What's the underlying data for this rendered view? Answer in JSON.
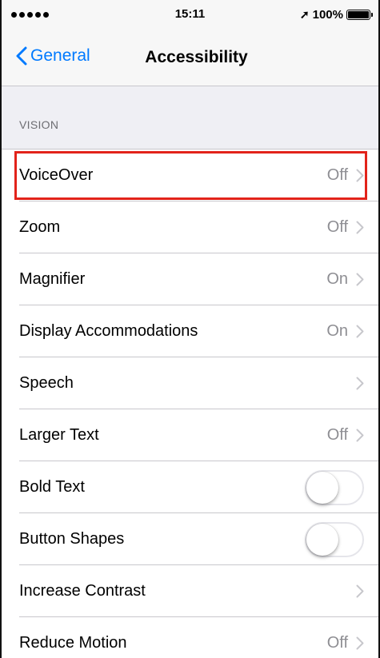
{
  "status_bar": {
    "time": "15:11",
    "location_icon": "location-arrow-icon",
    "battery_percent_label": "100%",
    "battery_level": 1.0
  },
  "nav": {
    "back_label": "General",
    "title": "Accessibility"
  },
  "section": {
    "header": "VISION",
    "rows": [
      {
        "label": "VoiceOver",
        "value": "Off",
        "type": "disclosure",
        "highlighted": true
      },
      {
        "label": "Zoom",
        "value": "Off",
        "type": "disclosure"
      },
      {
        "label": "Magnifier",
        "value": "On",
        "type": "disclosure"
      },
      {
        "label": "Display Accommodations",
        "value": "On",
        "type": "disclosure"
      },
      {
        "label": "Speech",
        "value": "",
        "type": "disclosure"
      },
      {
        "label": "Larger Text",
        "value": "Off",
        "type": "disclosure"
      },
      {
        "label": "Bold Text",
        "type": "toggle",
        "on": false
      },
      {
        "label": "Button Shapes",
        "type": "toggle",
        "on": false
      },
      {
        "label": "Increase Contrast",
        "value": "",
        "type": "disclosure"
      },
      {
        "label": "Reduce Motion",
        "value": "Off",
        "type": "disclosure"
      }
    ]
  },
  "colors": {
    "accent": "#007aff",
    "highlight": "#e2231a",
    "secondary_text": "#8e8e93",
    "background": "#efeff4"
  }
}
